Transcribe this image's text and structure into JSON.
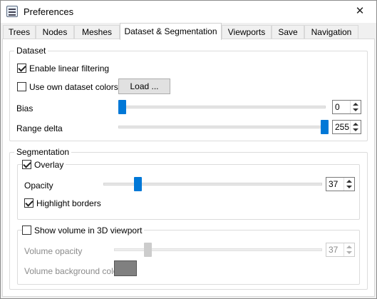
{
  "window": {
    "title": "Preferences",
    "close_glyph": "✕",
    "icon": "preferences-icon"
  },
  "tabs": [
    {
      "label": "Trees"
    },
    {
      "label": "Nodes"
    },
    {
      "label": "Meshes"
    },
    {
      "label": "Dataset & Segmentation",
      "active": true
    },
    {
      "label": "Viewports"
    },
    {
      "label": "Save"
    },
    {
      "label": "Navigation"
    }
  ],
  "dataset": {
    "title": "Dataset",
    "linear_filtering": {
      "label": "Enable linear filtering",
      "checked": true
    },
    "own_colors": {
      "label": "Use own dataset colors",
      "checked": false
    },
    "load_button": "Load ...",
    "bias": {
      "label": "Bias",
      "value": "0"
    },
    "range_delta": {
      "label": "Range delta",
      "value": "255"
    }
  },
  "segmentation": {
    "title": "Segmentation",
    "overlay": {
      "label": "Overlay",
      "checked": true
    },
    "opacity": {
      "label": "Opacity",
      "value": "37"
    },
    "highlight_borders": {
      "label": "Highlight borders",
      "checked": true
    },
    "show_volume": {
      "label": "Show volume in 3D viewport",
      "checked": false
    },
    "volume_opacity": {
      "label": "Volume opacity",
      "value": "37"
    },
    "volume_bg_color": {
      "label": "Volume background color",
      "color": "#808080"
    }
  },
  "colors": {
    "accent": "#0078d7"
  }
}
